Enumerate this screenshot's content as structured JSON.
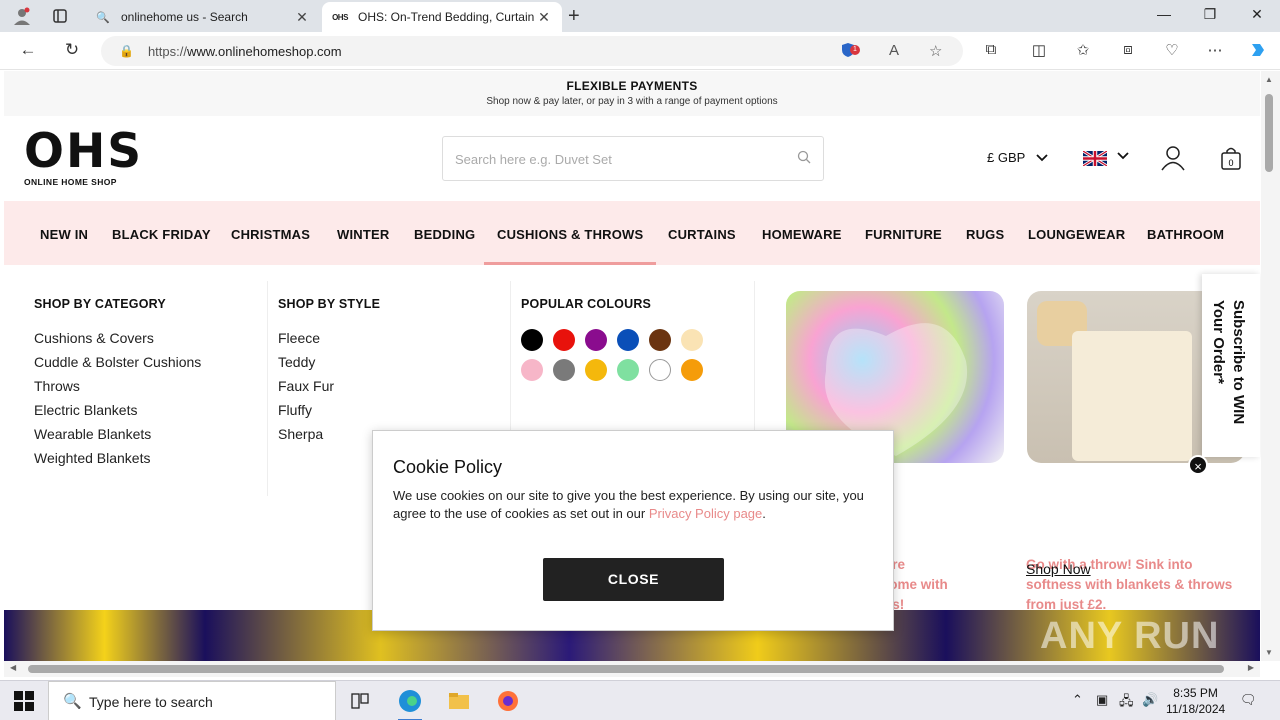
{
  "browser": {
    "tabs": [
      {
        "title": "onlinehome us - Search",
        "icon": "search-icon"
      },
      {
        "title": "OHS: On-Trend Bedding, Curtain",
        "icon": "OHS"
      }
    ],
    "url_prefix": "https://",
    "url_host": "www.onlinehomeshop.com",
    "extension_badge": "1"
  },
  "promo": {
    "heading": "FLEXIBLE PAYMENTS",
    "subtext": "Shop now & pay later, or pay in 3 with a range of payment options"
  },
  "header": {
    "logo_big": "OHS",
    "logo_small": "ONLINE HOME SHOP",
    "search_placeholder": "Search here e.g. Duvet Set",
    "currency": "£ GBP",
    "bag_count": "0"
  },
  "nav": [
    "NEW IN",
    "BLACK FRIDAY",
    "CHRISTMAS",
    "WINTER",
    "BEDDING",
    "CUSHIONS & THROWS",
    "CURTAINS",
    "HOMEWARE",
    "FURNITURE",
    "RUGS",
    "LOUNGEWEAR",
    "BATHROOM"
  ],
  "mega_menu": {
    "category_title": "SHOP BY CATEGORY",
    "categories": [
      "Cushions & Covers",
      "Cuddle & Bolster Cushions",
      "Throws",
      "Electric Blankets",
      "Wearable Blankets",
      "Weighted Blankets"
    ],
    "style_title": "SHOP BY STYLE",
    "styles": [
      "Fleece",
      "Teddy",
      "Faux Fur",
      "Fluffy",
      "Sherpa"
    ],
    "colours_title": "POPULAR COLOURS",
    "colours": [
      "#000000",
      "#e8120c",
      "#8a0c8e",
      "#0a4fb8",
      "#6b3410",
      "#fae3b4",
      "#f7b6c8",
      "#7a7a7a",
      "#f4b80c",
      "#7fe0a0",
      "#ffffff",
      "#f59c0a"
    ],
    "promo1_text": [
      "xture",
      "r home with",
      "ions!"
    ],
    "promo2_text": [
      "Go with a throw! Sink into",
      "softness with blankets & throws",
      "from just £2."
    ],
    "shop_now": "Shop Now"
  },
  "subscribe": "Subscribe to WIN Your Order*",
  "cookie": {
    "title": "Cookie Policy",
    "body": "We use cookies on our site to give you the best experience. By using our site, you agree to the use of cookies as set out in our ",
    "link": "Privacy Policy page",
    "body_end": ".",
    "button": "CLOSE"
  },
  "watermark": "ANY RUN",
  "taskbar": {
    "search_placeholder": "Type here to search",
    "time": "8:35 PM",
    "date": "11/18/2024"
  }
}
